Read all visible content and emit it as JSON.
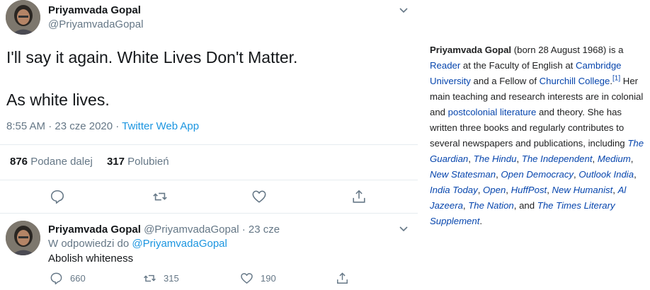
{
  "tweet": {
    "author_name": "Priyamvada Gopal",
    "author_handle": "@PriyamvadaGopal",
    "text_line1": "I'll say it again. White Lives Don't Matter.",
    "text_line2": "As white lives.",
    "timestamp": "8:55 AM · 23 cze 2020 · ",
    "source": "Twitter Web App",
    "retweets_count": "876",
    "retweets_label": "Podane dalej",
    "likes_count": "317",
    "likes_label": "Polubień",
    "actions": [
      "reply-icon",
      "retweet-icon",
      "like-icon",
      "share-icon"
    ]
  },
  "reply": {
    "author_name": "Priyamvada Gopal",
    "author_handle": "@PriyamvadaGopal · 23 cze",
    "replying_to_label": "W odpowiedzi do ",
    "replying_to_handle": "@PriyamvadaGopal",
    "text": "Abolish whiteness",
    "reply_count": "660",
    "retweet_count": "315",
    "like_count": "190"
  },
  "wiki": {
    "name": "Priyamvada Gopal",
    "t1": " (born 28 August 1968) is a ",
    "l_reader": "Reader",
    "t2": " at the Faculty of English at ",
    "l_cambridge": "Cambridge University",
    "t3": " and a Fellow of ",
    "l_churchill": "Churchill College",
    "t4": ".",
    "ref1": "[1]",
    "t5": " Her main teaching and research interests are in colonial and ",
    "l_postcolonial": "postcolonial literature",
    "t6": " and theory. She has written three books and regularly contributes to several newspapers and publications, including ",
    "p1": "The Guardian",
    "c1": ", ",
    "p2": "The Hindu",
    "c2": ", ",
    "p3": "The Independent",
    "c3": ", ",
    "p4": "Medium",
    "c4": ", ",
    "p5": "New Statesman",
    "c5": ", ",
    "p6": "Open Democracy",
    "c6": ", ",
    "p7": "Outlook India",
    "c7": ", ",
    "p8": "India Today",
    "c8": ", ",
    "p9": "Open",
    "c9": ", ",
    "p10": "HuffPost",
    "c10": ", ",
    "p11": "New Humanist",
    "c11": ", ",
    "p12": "Al Jazeera",
    "c12": ", ",
    "p13": "The Nation",
    "c13": ", and ",
    "p14": "The Times Literary Supplement",
    "c14": "."
  },
  "colors": {
    "link_blue": "#1b95e0",
    "muted_gray": "#657786",
    "wiki_link": "#0645ad"
  }
}
